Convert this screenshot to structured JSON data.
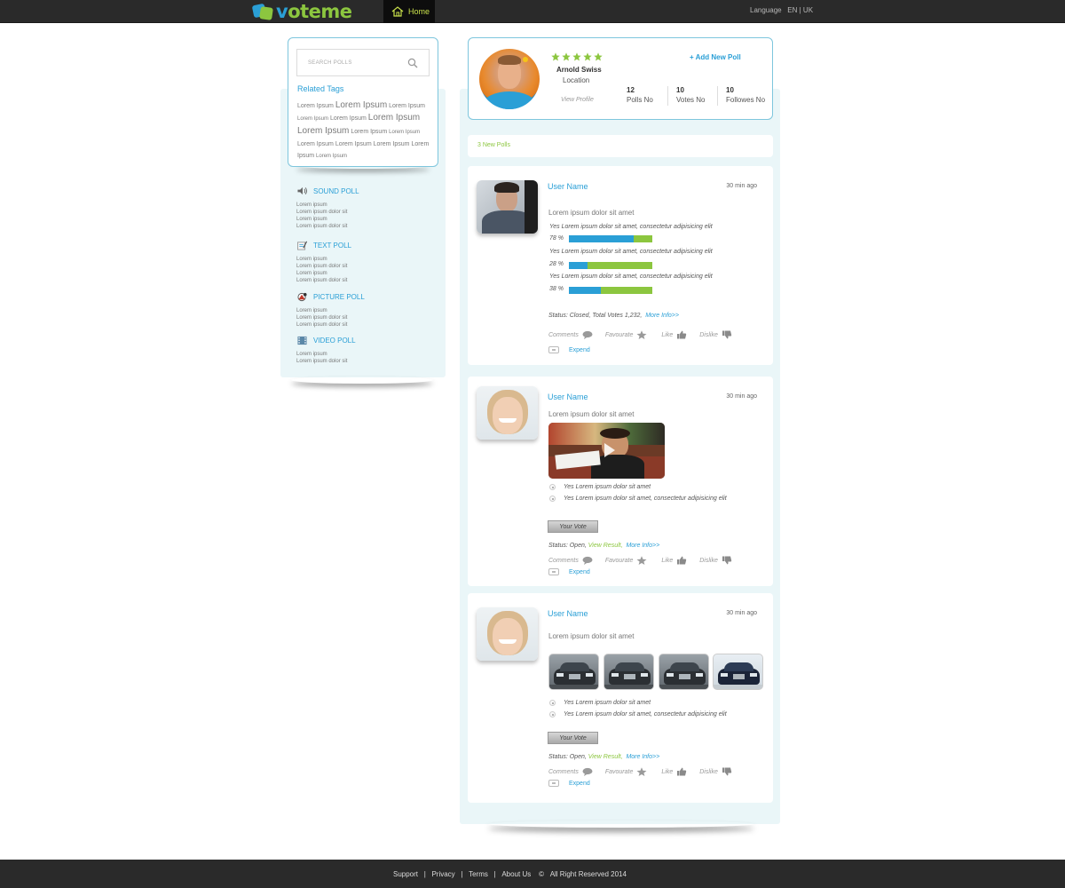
{
  "header": {
    "logo_text_v": "v",
    "logo_text_rest": "oteme",
    "home_label": "Home",
    "language_label": "Language",
    "lang_en": "EN",
    "lang_sep": " | ",
    "lang_uk": "UK"
  },
  "sidebar": {
    "search_placeholder": "SEARCH POLLS",
    "related_tags_title": "Related Tags",
    "tags": [
      {
        "text": "Lorem Ipsum",
        "size": "t1"
      },
      {
        "text": "Lorem Ipsum",
        "size": "t3"
      },
      {
        "text": "Lorem Ipsum",
        "size": "t1"
      },
      {
        "text": "Lorem Ipsum",
        "size": "t0"
      },
      {
        "text": "Lorem Ipsum",
        "size": "t1"
      },
      {
        "text": "Lorem Ipsum",
        "size": "t3"
      },
      {
        "text": "Lorem Ipsum",
        "size": "t3"
      },
      {
        "text": "Lorem Ipsum",
        "size": "t1"
      },
      {
        "text": "Lorem Ipsum",
        "size": "t0"
      },
      {
        "text": "Lorem Ipsum",
        "size": "t1"
      },
      {
        "text": "Lorem Ipsum",
        "size": "t1"
      },
      {
        "text": "Lorem Ipsum",
        "size": "t1"
      },
      {
        "text": "Lorem Ipsum",
        "size": "t1"
      },
      {
        "text": "Lorem Ipsum",
        "size": "t0"
      }
    ],
    "categories": [
      {
        "title": "SOUND POLL",
        "icon": "speaker-icon",
        "items": [
          "Lorem ipsum",
          "Lorem ipsum dolor sit",
          "Lorem ipsum",
          "Lorem ipsum dolor sit"
        ]
      },
      {
        "title": "TEXT POLL",
        "icon": "notepad-icon",
        "items": [
          "Lorem ipsum",
          "Lorem ipsum dolor sit",
          "Lorem ipsum",
          "Lorem ipsum dolor sit"
        ]
      },
      {
        "title": "PICTURE POLL",
        "icon": "picture-icon",
        "items": [
          "Lorem ipsum",
          "Lorem ipsum dolor sit",
          "Lorem ipsum dolor sit"
        ]
      },
      {
        "title": "VIDEO POLL",
        "icon": "film-icon",
        "items": [
          "Lorem ipsum",
          "Lorem ipsum dolor sit"
        ]
      }
    ]
  },
  "profile": {
    "rating": 5,
    "name": "Arnold Swiss",
    "location": "Location",
    "view_profile": "View Profile",
    "add_poll": "+ Add New Poll",
    "stats": [
      {
        "value": "12",
        "label": "Polls No"
      },
      {
        "value": "10",
        "label": "Votes No"
      },
      {
        "value": "10",
        "label": "Followes No"
      }
    ]
  },
  "new_polls_label": "3 New Polls",
  "polls": [
    {
      "user": "User Name",
      "time": "30 min ago",
      "question": "Lorem ipsum dolor sit amet",
      "answers": [
        {
          "text": "Yes Lorem ipsum dolor sit amet, consectetur adipisicing elit",
          "percent_label": "78 %",
          "percent": 78
        },
        {
          "text": "Yes Lorem ipsum dolor sit amet, consectetur adipisicing elit",
          "percent_label": "28 %",
          "percent": 22
        },
        {
          "text": "Yes Lorem ipsum dolor sit amet, consectetur adipisicing elit",
          "percent_label": "38 %",
          "percent": 38
        }
      ],
      "status_prefix": "Status: Closed, Total Votes 1,232,",
      "more_info": "More Info>>",
      "actions": {
        "comments": "Comments",
        "favourite": "Favourate",
        "like": "Like",
        "dislike": "Dislike"
      },
      "expand": "Expend"
    },
    {
      "user": "User Name",
      "time": "30 min ago",
      "question": "Lorem ipsum dolor sit amet",
      "options": [
        "Yes Lorem ipsum dolor sit amet",
        "Yes Lorem ipsum dolor sit amet, consectetur adipisicing elit"
      ],
      "vote_label": "Your Vote",
      "status_prefix": "Status: Open,",
      "view_result": "View Result,",
      "more_info": "More Info>>",
      "actions": {
        "comments": "Comments",
        "favourite": "Favourate",
        "like": "Like",
        "dislike": "Dislike"
      },
      "expand": "Expend"
    },
    {
      "user": "User Name",
      "time": "30 min ago",
      "question": "Lorem ipsum dolor sit amet",
      "options": [
        "Yes Lorem ipsum dolor sit amet",
        "Yes Lorem ipsum dolor sit amet, consectetur adipisicing elit"
      ],
      "vote_label": "Your Vote",
      "status_prefix": "Status: Open,",
      "view_result": "View Result,",
      "more_info": "More Info>>",
      "actions": {
        "comments": "Comments",
        "favourite": "Favourate",
        "like": "Like",
        "dislike": "Dislike"
      },
      "expand": "Expend"
    }
  ],
  "footer": {
    "links": [
      "Support",
      "Privacy",
      "Terms",
      "About Us"
    ],
    "copyright_symbol": "©",
    "copyright": "All Right Reserved 2014"
  },
  "colors": {
    "brand_blue": "#2a9fd6",
    "brand_green": "#8cc63f",
    "bar_dark": "#2a2a2a",
    "panel_bg": "#eaf6f8"
  }
}
